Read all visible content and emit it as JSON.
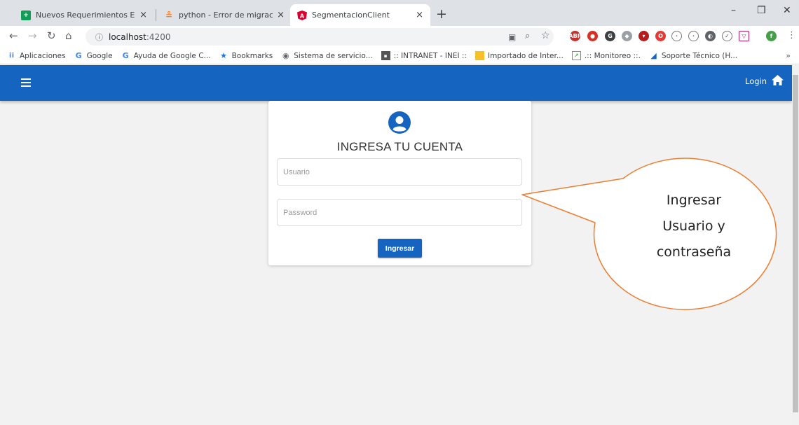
{
  "browser": {
    "tabs": [
      {
        "title": "Nuevos Requerimientos Elegajo",
        "favicon": "sheets-icon",
        "color": "#0f9d58"
      },
      {
        "title": "python - Error de migración de D",
        "favicon": "stackoverflow-icon",
        "color": "#f48024"
      },
      {
        "title": "SegmentacionClient",
        "favicon": "angular-icon",
        "color": "#dd0031"
      }
    ],
    "url_host": "localhost",
    "url_port": ":4200",
    "bookmarks": [
      {
        "label": "Aplicaciones",
        "icon": "apps-grid-icon"
      },
      {
        "label": "Google",
        "icon": "google-icon"
      },
      {
        "label": "Ayuda de Google C...",
        "icon": "google-icon"
      },
      {
        "label": "Bookmarks",
        "icon": "star-icon"
      },
      {
        "label": "Sistema de servicio...",
        "icon": "globe-icon"
      },
      {
        "label": ":: INTRANET - INEI ::",
        "icon": "intranet-icon"
      },
      {
        "label": "Importado de Inter...",
        "icon": "folder-icon"
      },
      {
        "label": ".:: Monitoreo ::.",
        "icon": "chart-icon"
      },
      {
        "label": "Soporte Técnico (H...",
        "icon": "support-icon"
      }
    ]
  },
  "app": {
    "login_link": "Login",
    "brand_color": "#1565c0"
  },
  "card": {
    "title": "INGRESA TU CUENTA",
    "username_placeholder": "Usuario",
    "password_placeholder": "Password",
    "submit_label": "Ingresar"
  },
  "callout": {
    "lines": [
      "Ingresar",
      "Usuario y",
      "contraseña"
    ],
    "fill": "#ffffff",
    "stroke": "#ed7d31"
  }
}
